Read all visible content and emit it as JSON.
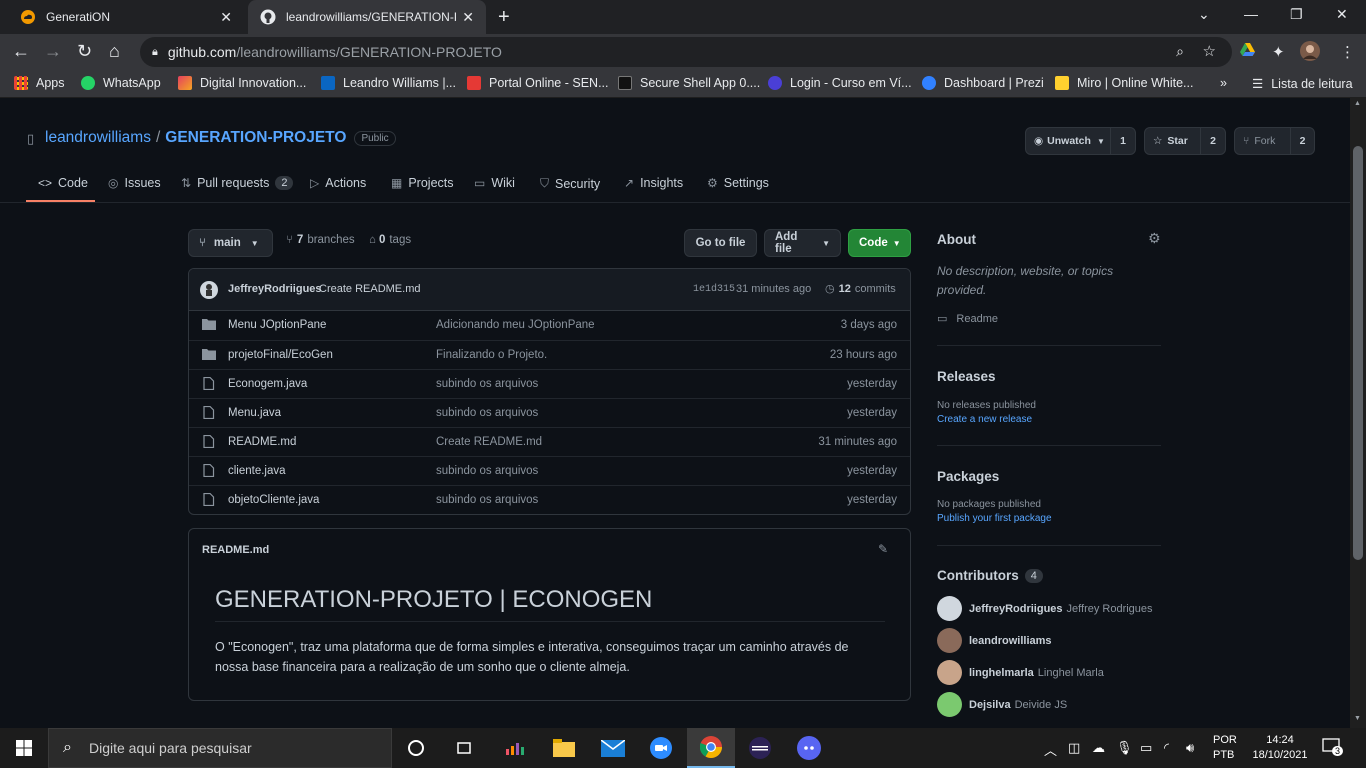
{
  "browser": {
    "tabs": [
      {
        "title": "GeneratiON",
        "active": false,
        "icon": "cloud-icon"
      },
      {
        "title": "leandrowilliams/GENERATION-PROJETO",
        "active": true,
        "icon": "github-icon"
      }
    ],
    "url_host": "github.com",
    "url_path": "/leandrowilliams/GENERATION-PROJETO",
    "bookmarks": [
      {
        "label": "Apps",
        "icon": "apps-grid-icon"
      },
      {
        "label": "WhatsApp",
        "icon": "whatsapp-icon"
      },
      {
        "label": "Digital Innovation...",
        "icon": "dio-icon"
      },
      {
        "label": "Leandro Williams |...",
        "icon": "linkedin-icon"
      },
      {
        "label": "Portal Online - SEN...",
        "icon": "senac-icon"
      },
      {
        "label": "Secure Shell App 0....",
        "icon": "terminal-icon"
      },
      {
        "label": "Login - Curso em Ví...",
        "icon": "curso-em-video-icon"
      },
      {
        "label": "Dashboard | Prezi",
        "icon": "prezi-icon"
      },
      {
        "label": "Miro | Online White...",
        "icon": "miro-icon"
      }
    ],
    "overflow_label": "»",
    "reading_list_label": "Lista de leitura"
  },
  "repo": {
    "owner": "leandrowilliams",
    "separator": "/",
    "name": "GENERATION-PROJETO",
    "visibility": "Public",
    "unwatch_label": "Unwatch",
    "watch_count": "1",
    "star_label": "Star",
    "star_count": "2",
    "fork_label": "Fork",
    "fork_count": "2"
  },
  "nav": {
    "code": "Code",
    "issues": "Issues",
    "pulls": "Pull requests",
    "pulls_count": "2",
    "actions": "Actions",
    "projects": "Projects",
    "wiki": "Wiki",
    "security": "Security",
    "insights": "Insights",
    "settings": "Settings"
  },
  "branchbar": {
    "branch": "main",
    "branches_count": "7",
    "branches_label": "branches",
    "tags_count": "0",
    "tags_label": "tags",
    "goto_file": "Go to file",
    "add_file": "Add file",
    "code_btn": "Code"
  },
  "commit": {
    "author": "JeffreyRodriigues",
    "message": "Create README.md",
    "sha": "1e1d315",
    "age": "31 minutes ago",
    "count": "12",
    "count_label": "commits"
  },
  "files": [
    {
      "type": "folder",
      "name": "Menu JOptionPane",
      "message": "Adicionando meu JOptionPane",
      "age": "3 days ago"
    },
    {
      "type": "folder",
      "name": "projetoFinal/EcoGen",
      "message": "Finalizando o Projeto.",
      "age": "23 hours ago"
    },
    {
      "type": "file",
      "name": "Econogem.java",
      "message": "subindo os arquivos",
      "age": "yesterday"
    },
    {
      "type": "file",
      "name": "Menu.java",
      "message": "subindo os arquivos",
      "age": "yesterday"
    },
    {
      "type": "file",
      "name": "README.md",
      "message": "Create README.md",
      "age": "31 minutes ago"
    },
    {
      "type": "file",
      "name": "cliente.java",
      "message": "subindo os arquivos",
      "age": "yesterday"
    },
    {
      "type": "file",
      "name": "objetoCliente.java",
      "message": "subindo os arquivos",
      "age": "yesterday"
    }
  ],
  "readme": {
    "filename": "README.md",
    "heading": "GENERATION-PROJETO | ECONOGEN",
    "body": "O \"Econogen\", traz uma plataforma que de forma simples e interativa, conseguimos traçar um caminho através de nossa base financeira para a realização de um sonho que o cliente almeja."
  },
  "about": {
    "title": "About",
    "description": "No description, website, or topics provided.",
    "readme_link": "Readme",
    "releases_title": "Releases",
    "releases_text": "No releases published",
    "releases_link": "Create a new release",
    "packages_title": "Packages",
    "packages_text": "No packages published",
    "packages_link": "Publish your first package",
    "contributors_title": "Contributors",
    "contributors_count": "4",
    "contributors": [
      {
        "login": "JeffreyRodriigues",
        "name": "Jeffrey Rodrigues",
        "color": "#d0d7de"
      },
      {
        "login": "leandrowilliams",
        "name": "",
        "color": "#8a6a5a"
      },
      {
        "login": "linghelmarla",
        "name": "Linghel Marla",
        "color": "#c8a48a"
      },
      {
        "login": "Dejsilva",
        "name": "Deivide JS",
        "color": "#7bc96f"
      }
    ]
  },
  "taskbar": {
    "search_placeholder": "Digite aqui para pesquisar",
    "lang_top": "POR",
    "lang_bottom": "PTB",
    "time": "14:24",
    "date": "18/10/2021",
    "notification_count": "3"
  },
  "colors": {
    "github_bg": "#0d1117",
    "accent_green": "#238636",
    "link_blue": "#58a6ff",
    "nav_underline": "#f78166"
  }
}
